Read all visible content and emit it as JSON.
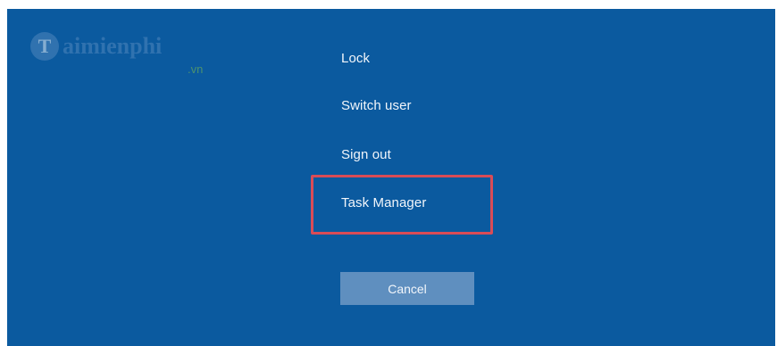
{
  "watermark": {
    "brand_initial": "T",
    "brand_text": "aimienphi",
    "brand_tld": ".vn"
  },
  "menu": {
    "lock": "Lock",
    "switch_user": "Switch user",
    "sign_out": "Sign out",
    "task_manager": "Task Manager"
  },
  "cancel_label": "Cancel",
  "colors": {
    "background": "#0b5a9f",
    "highlight": "#d94c57",
    "button": "#5f8fbf",
    "text": "#f2f6fb"
  }
}
